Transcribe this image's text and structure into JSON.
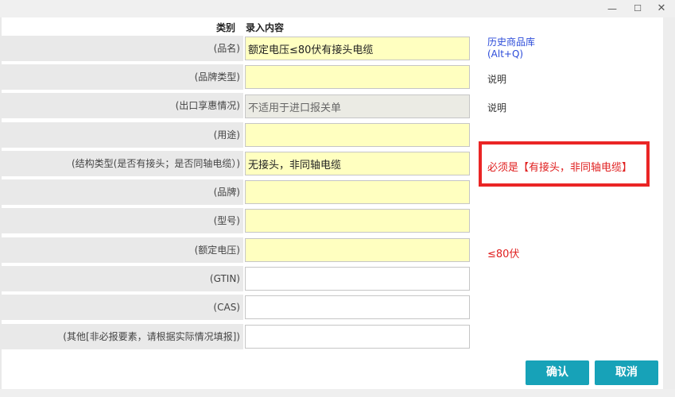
{
  "window": {
    "minimize": "—",
    "maximize": "☐",
    "close": "✕"
  },
  "header": {
    "category": "类别",
    "content": "录入内容"
  },
  "rows": [
    {
      "label": "(品名)",
      "value": "额定电压≤80伏有接头电缆",
      "field": "yellow"
    },
    {
      "label": "(品牌类型)",
      "value": "",
      "field": "yellow"
    },
    {
      "label": "(出口享惠情况)",
      "value": "不适用于进口报关单",
      "field": "disabled"
    },
    {
      "label": "(用途)",
      "value": "",
      "field": "yellow"
    },
    {
      "label": "(结构类型(是否有接头；是否同轴电缆）)",
      "value": "无接头，非同轴电缆",
      "field": "yellow"
    },
    {
      "label": "(品牌)",
      "value": "",
      "field": "yellow"
    },
    {
      "label": "(型号)",
      "value": "",
      "field": "yellow"
    },
    {
      "label": "(额定电压)",
      "value": "",
      "field": "yellow"
    },
    {
      "label": "(GTIN)",
      "value": "",
      "field": "white"
    },
    {
      "label": "(CAS)",
      "value": "",
      "field": "white"
    },
    {
      "label": "(其他[非必报要素，请根据实际情况填报])",
      "value": "",
      "field": "white"
    }
  ],
  "side": {
    "history_link_line1": "历史商品库",
    "history_link_line2": "(Alt+Q)",
    "brand_type_note": "说明",
    "export_note": "说明",
    "structure_hint": "必须是【有接头，非同轴电缆】",
    "voltage_hint": "≤80伏",
    "colors": {
      "hint_red": "#e02020",
      "link_blue": "#2b4bd9",
      "field_yellow": "#ffffc0",
      "button_teal": "#17a2b8"
    }
  },
  "buttons": {
    "confirm": "确认",
    "cancel": "取消"
  }
}
